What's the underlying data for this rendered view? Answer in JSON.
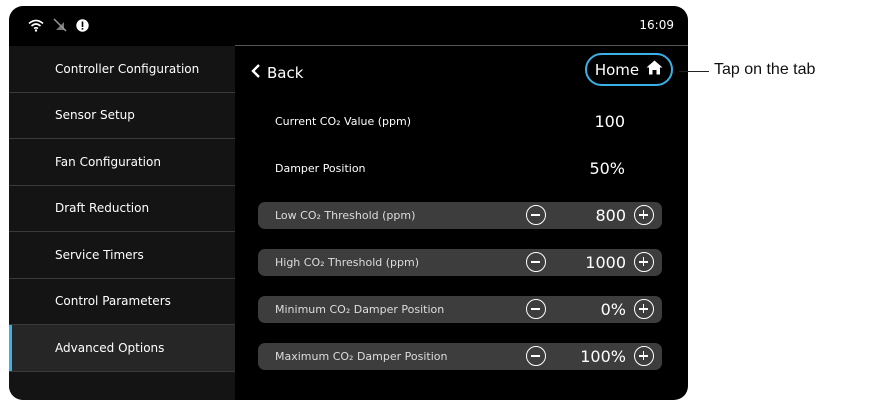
{
  "status": {
    "time": "16:09",
    "notification_badge": "!"
  },
  "sidebar": {
    "items": [
      {
        "label": "Controller Configuration"
      },
      {
        "label": "Sensor Setup"
      },
      {
        "label": "Fan Configuration"
      },
      {
        "label": "Draft Reduction"
      },
      {
        "label": "Service Timers"
      },
      {
        "label": "Control Parameters"
      },
      {
        "label": "Advanced Options",
        "active": true
      }
    ]
  },
  "header": {
    "back_label": "Back",
    "home_label": "Home"
  },
  "info": [
    {
      "label": "Current CO₂ Value (ppm)",
      "value": "100"
    },
    {
      "label": "Damper Position",
      "value": "50%"
    }
  ],
  "settings": [
    {
      "label": "Low CO₂ Threshold (ppm)",
      "value": "800"
    },
    {
      "label": "High CO₂ Threshold (ppm)",
      "value": "1000"
    },
    {
      "label": "Minimum CO₂ Damper Position",
      "value": "0%"
    },
    {
      "label": "Maximum CO₂ Damper Position",
      "value": "100%"
    }
  ],
  "callout": {
    "text": "Tap on the tab"
  },
  "colors": {
    "accent": "#3ab0e6",
    "background": "#000000",
    "row": "#3d3d3d"
  },
  "icons": [
    "wifi-icon",
    "no-bluetooth-icon",
    "alert-icon",
    "chevron-left-icon",
    "home-icon",
    "minus-circle-icon",
    "plus-circle-icon"
  ]
}
